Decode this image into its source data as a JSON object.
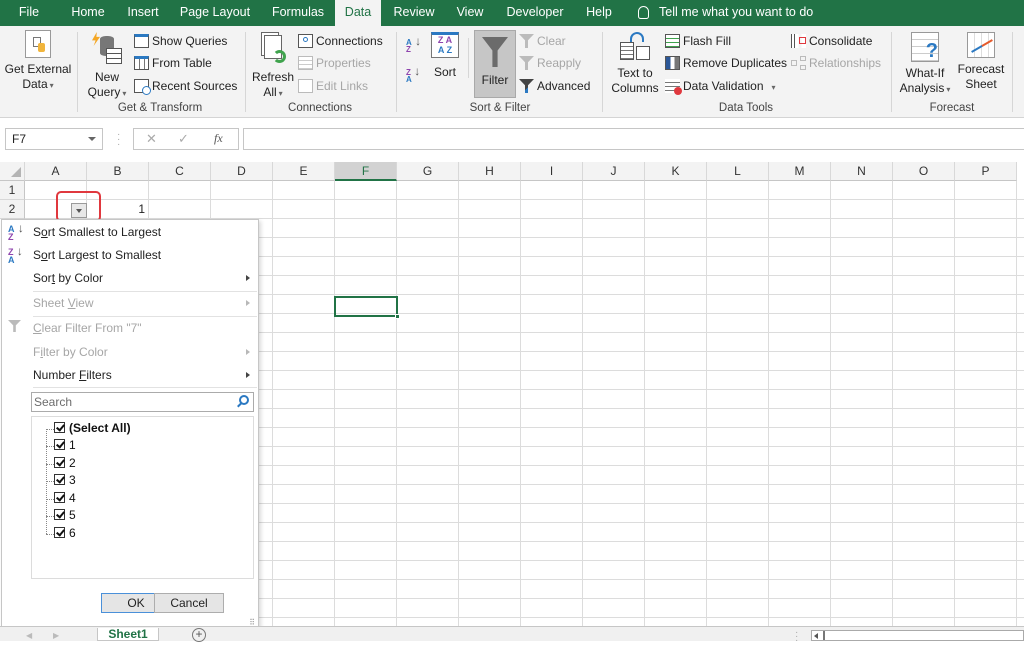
{
  "tabs": [
    {
      "label": "File",
      "active": false
    },
    {
      "label": "Home",
      "active": false
    },
    {
      "label": "Insert",
      "active": false
    },
    {
      "label": "Page Layout",
      "active": false
    },
    {
      "label": "Formulas",
      "active": false
    },
    {
      "label": "Data",
      "active": true
    },
    {
      "label": "Review",
      "active": false
    },
    {
      "label": "View",
      "active": false
    },
    {
      "label": "Developer",
      "active": false
    },
    {
      "label": "Help",
      "active": false
    }
  ],
  "tell_me": "Tell me what you want to do",
  "ribbon": {
    "get_external_data": {
      "line1": "Get External",
      "line2": "Data"
    },
    "new_query": {
      "line1": "New",
      "line2": "Query"
    },
    "show_queries": "Show Queries",
    "from_table": "From Table",
    "recent_sources": "Recent Sources",
    "group_get_transform": "Get & Transform",
    "refresh_all": {
      "line1": "Refresh",
      "line2": "All"
    },
    "connections": "Connections",
    "properties": "Properties",
    "edit_links": "Edit Links",
    "group_connections": "Connections",
    "sort": "Sort",
    "filter": "Filter",
    "clear": "Clear",
    "reapply": "Reapply",
    "advanced": "Advanced",
    "group_sort_filter": "Sort & Filter",
    "text_to_columns": {
      "line1": "Text to",
      "line2": "Columns"
    },
    "flash_fill": "Flash Fill",
    "remove_duplicates": "Remove Duplicates",
    "data_validation": "Data Validation",
    "consolidate": "Consolidate",
    "relationships": "Relationships",
    "group_data_tools": "Data Tools",
    "what_if": {
      "line1": "What-If",
      "line2": "Analysis"
    },
    "forecast_sheet": {
      "line1": "Forecast",
      "line2": "Sheet"
    },
    "group_forecast": "Forecast"
  },
  "formula_bar": {
    "name_box": "F7",
    "cancel_icon": "✕",
    "enter_icon": "✓",
    "fx_label": "fx",
    "formula": ""
  },
  "grid": {
    "columns": [
      "A",
      "B",
      "C",
      "D",
      "E",
      "F",
      "G",
      "H",
      "I",
      "J",
      "K",
      "L",
      "M",
      "N",
      "O",
      "P"
    ],
    "selected_column": "F",
    "row_headers": [
      "1",
      "2"
    ],
    "selected_cell": "F7",
    "cells": {
      "B2": "1"
    }
  },
  "filter_menu": {
    "sort_asc": {
      "pre": "S",
      "u": "o",
      "post": "rt Smallest to Largest"
    },
    "sort_desc": {
      "pre": "S",
      "u": "o",
      "post": "rt Largest to Smallest"
    },
    "sort_by_color": {
      "pre": "Sor",
      "u": "t",
      "post": " by Color"
    },
    "sheet_view": {
      "pre": "Sheet ",
      "u": "V",
      "post": "iew"
    },
    "clear_filter": {
      "pre": "",
      "u": "C",
      "post": "lear Filter From \"7\""
    },
    "filter_by_color": {
      "pre": "F",
      "u": "i",
      "post": "lter by Color"
    },
    "number_filters": {
      "pre": "Number ",
      "u": "F",
      "post": "ilters"
    },
    "search_placeholder": "Search",
    "items": [
      {
        "label": "(Select All)",
        "checked": true
      },
      {
        "label": "1",
        "checked": true
      },
      {
        "label": "2",
        "checked": true
      },
      {
        "label": "3",
        "checked": true
      },
      {
        "label": "4",
        "checked": true
      },
      {
        "label": "5",
        "checked": true
      },
      {
        "label": "6",
        "checked": true
      }
    ],
    "ok": "OK",
    "cancel": "Cancel"
  },
  "sheet_tabs": {
    "active": "Sheet1",
    "add": "+"
  }
}
